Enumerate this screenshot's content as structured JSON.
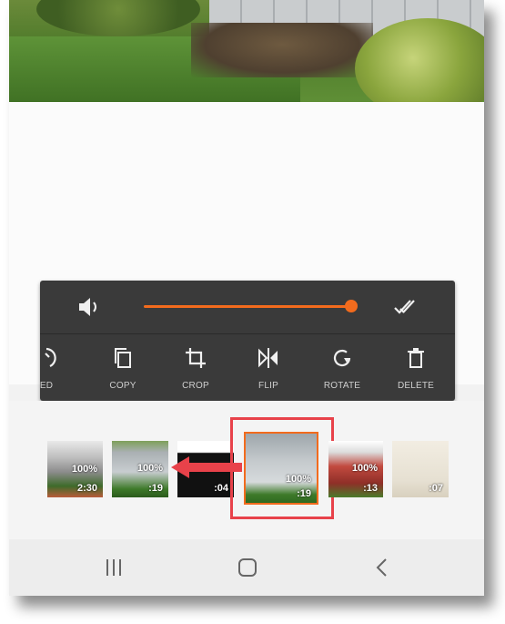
{
  "colors": {
    "accent": "#f26b1d",
    "selection_outline": "#e8424a",
    "panel_bg": "#3a3a3a",
    "panel_text": "#cfcfcf"
  },
  "volume": {
    "icon": "volume-icon",
    "level": 1.0,
    "confirm_icon": "double-check-icon"
  },
  "toolbar": {
    "items": [
      {
        "label": "ED",
        "icon": "speed-icon"
      },
      {
        "label": "COPY",
        "icon": "copy-icon"
      },
      {
        "label": "CROP",
        "icon": "crop-icon"
      },
      {
        "label": "FLIP",
        "icon": "flip-icon"
      },
      {
        "label": "ROTATE",
        "icon": "rotate-icon"
      },
      {
        "label": "DELETE",
        "icon": "delete-icon"
      }
    ]
  },
  "timeline": {
    "clips": [
      {
        "percent": "100%",
        "duration": "2:30"
      },
      {
        "percent": "100%",
        "duration": ":19"
      },
      {
        "percent": "",
        "duration": ":04"
      },
      {
        "percent": "100%",
        "duration": ":19",
        "selected": true
      },
      {
        "percent": "100%",
        "duration": ":13"
      },
      {
        "percent": "",
        "duration": ":07"
      }
    ]
  },
  "navigation": {
    "items": [
      {
        "icon": "recent-apps-icon"
      },
      {
        "icon": "home-icon"
      },
      {
        "icon": "back-icon"
      }
    ]
  }
}
